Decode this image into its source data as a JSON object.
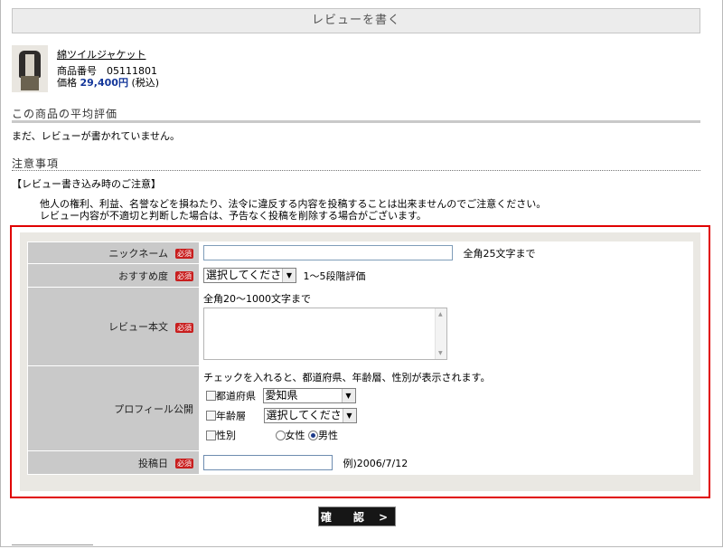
{
  "header": {
    "title": "レビューを書く"
  },
  "product": {
    "name": "綿ツイルジャケット",
    "code": "商品番号　05111801",
    "price_label": "価格",
    "price_value": "29,400円",
    "price_tax": "(税込)"
  },
  "rating_section": {
    "title": "この商品の平均評価",
    "empty_text": "まだ、レビューが書かれていません。"
  },
  "notice": {
    "title": "注意事項",
    "heading": "【レビュー書き込み時のご注意】",
    "line1": "他人の権利、利益、名誉などを損ねたり、法令に違反する内容を投稿することは出来ませんのでご注意ください。",
    "line2": "レビュー内容が不適切と判断した場合は、予告なく投稿を削除する場合がございます。"
  },
  "form": {
    "required_badge": "必須",
    "nickname": {
      "label": "ニックネーム",
      "value": "",
      "hint": "全角25文字まで"
    },
    "recommend": {
      "label": "おすすめ度",
      "selected": "選択してください",
      "hint": "1～5段階評価"
    },
    "body": {
      "label": "レビュー本文",
      "hint": "全角20～1000文字まで",
      "value": ""
    },
    "profile": {
      "label": "プロフィール公開",
      "note": "チェックを入れると、都道府県、年齢層、性別が表示されます。",
      "prefecture_label": "都道府県",
      "prefecture_value": "愛知県",
      "age_label": "年齢層",
      "age_value": "選択してください",
      "gender_label": "性別",
      "female": "女性",
      "male": "男性"
    },
    "date": {
      "label": "投稿日",
      "value": "",
      "hint": "例)2006/7/12"
    }
  },
  "actions": {
    "confirm": "確　認 >"
  },
  "colors": {
    "accent_red": "#e00000",
    "label_bg": "#c9c9c9",
    "price_blue": "#14379a"
  }
}
